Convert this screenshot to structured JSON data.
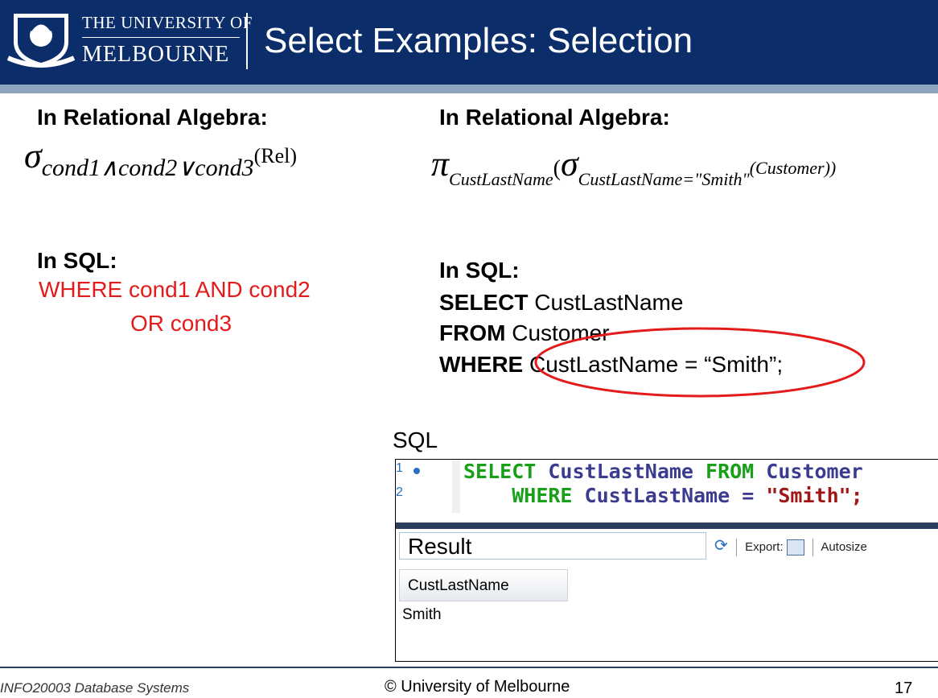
{
  "header": {
    "uni_line1": "THE UNIVERSITY OF",
    "uni_line2": "MELBOURNE",
    "title": "Select Examples: Selection"
  },
  "left": {
    "ra_heading": "In Relational Algebra:",
    "ra_sigma": "σ",
    "ra_subscript": "cond1∧cond2∨cond3",
    "ra_arg": "(Rel)",
    "sql_heading": "In SQL:",
    "sql_line1": "WHERE cond1 AND cond2",
    "sql_line2": "OR cond3"
  },
  "right": {
    "ra_heading": "In Relational Algebra:",
    "pi": "π",
    "pi_subscript": "CustLastName",
    "open": "(",
    "sigma": "σ",
    "sigma_subscript": "CustLastName=\"Smith\"",
    "arg": "(Customer))",
    "sql_heading": "In SQL:",
    "select_kw": "SELECT",
    "select_rest": " CustLastName",
    "from_kw": "FROM",
    "from_rest": " Customer",
    "where_kw": "WHERE",
    "where_rest": " CustLastName = “Smith”;"
  },
  "sql_panel": {
    "label": "SQL",
    "code_line1": {
      "kw_select": "SELECT",
      "col": " CustLastName ",
      "kw_from": "FROM",
      "table": " Customer"
    },
    "code_line2": {
      "kw_where": "WHERE",
      "expr": " CustLastName = ",
      "str": "\"Smith\";"
    },
    "result_title": "Result",
    "toolbar_export": "Export:",
    "toolbar_autosize": "Autosize",
    "column_header": "CustLastName",
    "cell_value": "Smith"
  },
  "footer": {
    "course": "INFO20003 Database Systems",
    "copyright": "© University of Melbourne",
    "page": "17"
  },
  "colors": {
    "header_bg": "#0b2d6a",
    "accent_red": "#e31b1b",
    "keyword_green": "#18a018",
    "keyword_blue": "#1a44c4"
  }
}
